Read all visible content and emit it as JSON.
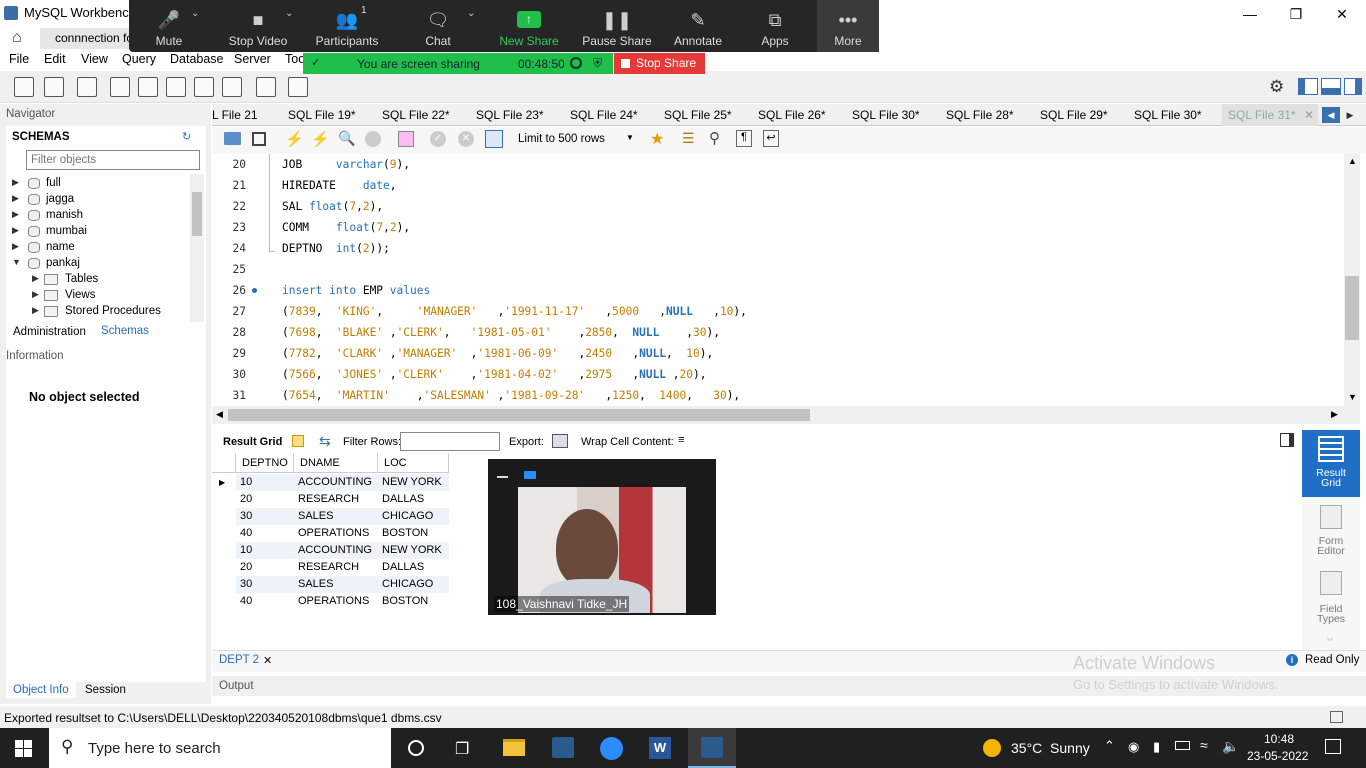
{
  "window": {
    "title": "MySQL Workbench"
  },
  "connection_tab": {
    "label": "connnection fo"
  },
  "menu": [
    "File",
    "Edit",
    "View",
    "Query",
    "Database",
    "Server",
    "Too"
  ],
  "zoom": {
    "buttons": [
      {
        "label": "Mute",
        "icon": "microphone-icon"
      },
      {
        "label": "Stop Video",
        "icon": "video-camera-icon"
      },
      {
        "label": "Participants",
        "icon": "participants-icon",
        "count": "1"
      },
      {
        "label": "Chat",
        "icon": "chat-icon"
      },
      {
        "label": "New Share",
        "icon": "share-arrow-icon"
      },
      {
        "label": "Pause Share",
        "icon": "pause-icon"
      },
      {
        "label": "Annotate",
        "icon": "pencil-icon"
      },
      {
        "label": "Apps",
        "icon": "apps-icon"
      },
      {
        "label": "More",
        "icon": "more-dots-icon"
      }
    ],
    "sharing_text": "You are screen sharing",
    "timer": "00:48:50",
    "stop_share": "Stop Share",
    "share_color": "#1fbf4a",
    "stop_color": "#e63a3a"
  },
  "navigator": {
    "header": "Navigator",
    "schemas_label": "SCHEMAS",
    "filter_placeholder": "Filter objects",
    "schemas": [
      "full",
      "jagga",
      "manish",
      "mumbai",
      "name",
      "pankaj"
    ],
    "pankaj_children": [
      "Tables",
      "Views",
      "Stored Procedures"
    ],
    "tab_admin": "Administration",
    "tab_schemas": "Schemas",
    "info_header": "Information",
    "no_object": "No object selected",
    "tab_object_info": "Object Info",
    "tab_session": "Session"
  },
  "sql_tabs": [
    "L File 21",
    "SQL File 19*",
    "SQL File 22*",
    "SQL File 23*",
    "SQL File 24*",
    "SQL File 25*",
    "SQL File 26*",
    "SQL File 30*",
    "SQL File 28*",
    "SQL File 29*",
    "SQL File 30*",
    "SQL File 31*"
  ],
  "sql_toolbar": {
    "limit": "Limit to 500 rows"
  },
  "editor": {
    "lines": [
      {
        "n": "20",
        "html": "JOB     <span class=\"kw\">varchar</span>(<span class=\"num\">9</span>),"
      },
      {
        "n": "21",
        "html": "HIREDATE    <span class=\"kw\">date</span>,"
      },
      {
        "n": "22",
        "html": "SAL <span class=\"kw\">float</span>(<span class=\"num\">7</span>,<span class=\"num\">2</span>),"
      },
      {
        "n": "23",
        "html": "COMM    <span class=\"kw\">float</span>(<span class=\"num\">7</span>,<span class=\"num\">2</span>),"
      },
      {
        "n": "24",
        "html": "DEPTNO  <span class=\"kw\">int</span>(<span class=\"num\">2</span>));"
      },
      {
        "n": "25",
        "html": ""
      },
      {
        "n": "26",
        "html": "<span class=\"kw\">insert into</span> EMP <span class=\"kw\">values</span>"
      },
      {
        "n": "27",
        "html": "(<span class=\"num\">7839</span>,  <span class=\"str\">'KING'</span>,     <span class=\"str\">'MANAGER'</span>   ,<span class=\"str\">'1991-11-17'</span>   ,<span class=\"num\">5000</span>   ,<span class=\"nl\">NULL</span>   ,<span class=\"num\">10</span>),"
      },
      {
        "n": "28",
        "html": "(<span class=\"num\">7698</span>,  <span class=\"str\">'BLAKE'</span> ,<span class=\"str\">'CLERK'</span>,   <span class=\"str\">'1981-05-01'</span>    ,<span class=\"num\">2850</span>,  <span class=\"nl\">NULL</span>    ,<span class=\"num\">30</span>),"
      },
      {
        "n": "29",
        "html": "(<span class=\"num\">7782</span>,  <span class=\"str\">'CLARK'</span> ,<span class=\"str\">'MANAGER'</span>  ,<span class=\"str\">'1981-06-09'</span>   ,<span class=\"num\">2450</span>   ,<span class=\"nl\">NULL</span>,  <span class=\"num\">10</span>),"
      },
      {
        "n": "30",
        "html": "(<span class=\"num\">7566</span>,  <span class=\"str\">'JONES'</span> ,<span class=\"str\">'CLERK'</span>    ,<span class=\"str\">'1981-04-02'</span>   ,<span class=\"num\">2975</span>   ,<span class=\"nl\">NULL</span> ,<span class=\"num\">20</span>),"
      },
      {
        "n": "31",
        "html": "(<span class=\"num\">7654</span>,  <span class=\"str\">'MARTIN'</span>    ,<span class=\"str\">'SALESMAN'</span> ,<span class=\"str\">'1981-09-28'</span>   ,<span class=\"num\">1250</span>,  <span class=\"num\">1400</span>,   <span class=\"num\">30</span>),"
      }
    ]
  },
  "result": {
    "toolbar": {
      "result_grid": "Result Grid",
      "filter_rows": "Filter Rows:",
      "export": "Export:",
      "wrap": "Wrap Cell Content:"
    },
    "columns": [
      "DEPTNO",
      "DNAME",
      "LOC"
    ],
    "rows": [
      [
        "10",
        "ACCOUNTING",
        "NEW YORK"
      ],
      [
        "20",
        "RESEARCH",
        "DALLAS"
      ],
      [
        "30",
        "SALES",
        "CHICAGO"
      ],
      [
        "40",
        "OPERATIONS",
        "BOSTON"
      ],
      [
        "10",
        "ACCOUNTING",
        "NEW YORK"
      ],
      [
        "20",
        "RESEARCH",
        "DALLAS"
      ],
      [
        "30",
        "SALES",
        "CHICAGO"
      ],
      [
        "40",
        "OPERATIONS",
        "BOSTON"
      ]
    ],
    "rail": [
      {
        "label": "Result\nGrid"
      },
      {
        "label": "Form\nEditor"
      },
      {
        "label": "Field\nTypes"
      }
    ],
    "tab": "DEPT 2",
    "read_only": "Read Only",
    "output_label": "Output"
  },
  "video": {
    "name": "108_Vaishnavi Tidke_JH"
  },
  "watermark": {
    "line1": "Activate Windows",
    "line2": "Go to Settings to activate Windows."
  },
  "status": {
    "text": "Exported resultset to C:\\Users\\DELL\\Desktop\\220340520108dbms\\que1 dbms.csv"
  },
  "taskbar": {
    "search_placeholder": "Type here to search",
    "weather": "35°C  Sunny",
    "time": "10:48",
    "date": "23-05-2022"
  }
}
